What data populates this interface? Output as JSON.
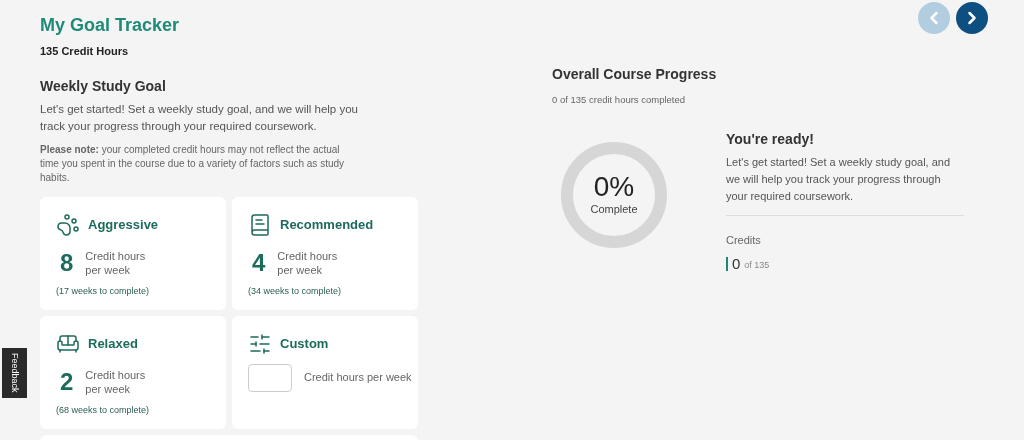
{
  "header": {
    "title": "My Goal Tracker",
    "subtitle": "135 Credit Hours"
  },
  "nav": [
    {
      "kind": "prev",
      "disabled": true
    },
    {
      "kind": "next",
      "disabled": false
    }
  ],
  "weekly_goal": {
    "title": "Weekly Study Goal",
    "intro": "Let's get started! Set a weekly study goal, and we will help you track your progress through your required coursework.",
    "note": "**Please note:** your completed credit hours may not reflect the actual time you spent in the course due to a variety of factors such as study habits.",
    "options": [
      {
        "kind": "preset",
        "label": "Aggressive",
        "value": "8",
        "unit": "Credit hours per week",
        "duration": "(17 weeks to complete)"
      },
      {
        "kind": "preset",
        "label": "Recommended",
        "value": "4",
        "unit": "Credit hours per week",
        "duration": "(34 weeks to complete)"
      },
      {
        "kind": "preset",
        "label": "Relaxed",
        "value": "2",
        "unit": "Credit hours per week",
        "duration": "(68 weeks to complete)"
      },
      {
        "kind": "custom",
        "label": "Custom",
        "unit": "Credit hours per week"
      }
    ]
  },
  "progress": {
    "title": "Overall Course Progress",
    "summary": "0 of 135 credit hours completed",
    "percent": "0%",
    "percent_label": "Complete",
    "status_title": "You're ready!",
    "status_text": "Let's get started! Set a weekly study goal, and we will help you track your progress through your required coursework.",
    "credits_label": "Credits",
    "credits_value": "0",
    "credits_total": "of 135"
  },
  "feedback": "Feedback"
}
